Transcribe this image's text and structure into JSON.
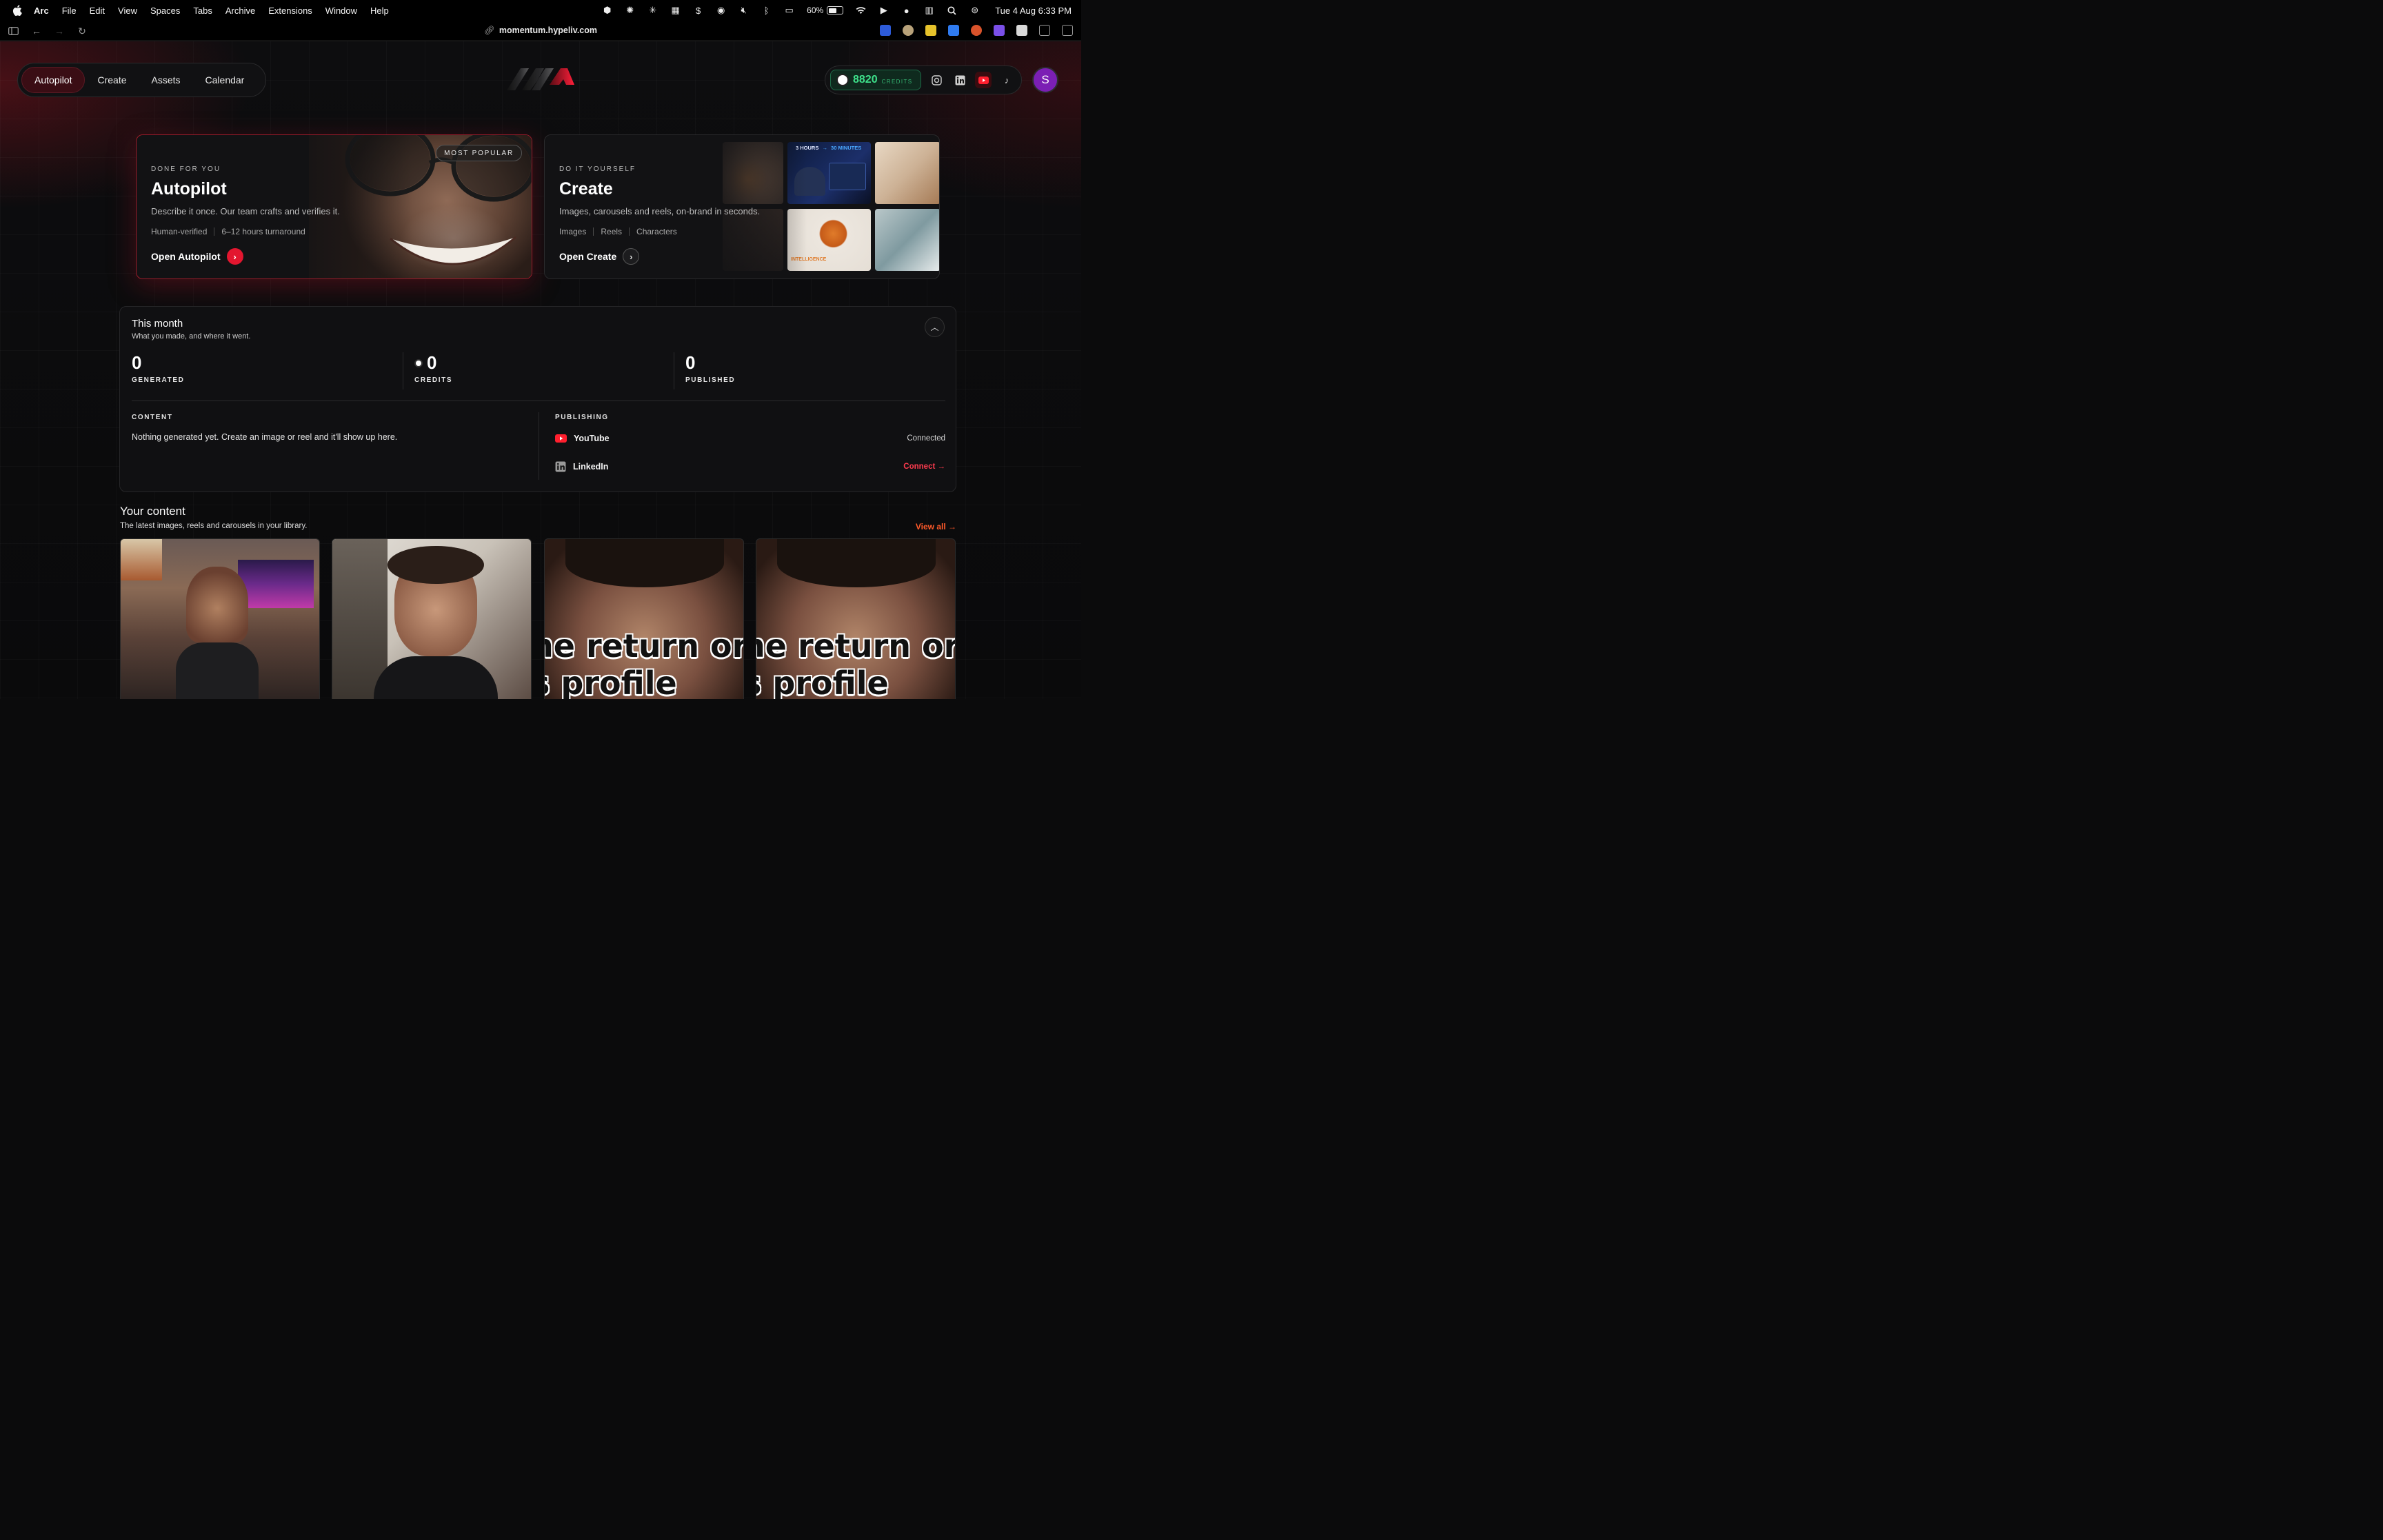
{
  "menubar": {
    "app": "Arc",
    "items": [
      "File",
      "Edit",
      "View",
      "Spaces",
      "Tabs",
      "Archive",
      "Extensions",
      "Window",
      "Help"
    ],
    "battery": "60%",
    "clock": "Tue 4 Aug  6:33 PM"
  },
  "browser": {
    "url": "momentum.hypeliv.com"
  },
  "nav": {
    "tabs": [
      "Autopilot",
      "Create",
      "Assets",
      "Calendar"
    ],
    "active": "Autopilot"
  },
  "header": {
    "credits_value": "8820",
    "credits_label": "CREDITS",
    "avatar_initial": "S"
  },
  "autopilot_card": {
    "badge": "MOST POPULAR",
    "eyebrow": "DONE FOR YOU",
    "title": "Autopilot",
    "description": "Describe it once. Our team crafts and verifies it.",
    "meta": [
      "Human-verified",
      "6–12 hours turnaround"
    ],
    "cta": "Open Autopilot"
  },
  "create_card": {
    "eyebrow": "DO IT YOURSELF",
    "title": "Create",
    "description": "Images, carousels and reels, on-brand in seconds.",
    "meta": [
      "Images",
      "Reels",
      "Characters"
    ],
    "cta": "Open Create",
    "thumb_text_1a": "3 HOURS",
    "thumb_text_1b": "30 MINUTES",
    "thumb_text_2": "INTELLIGENCE"
  },
  "month": {
    "title": "This month",
    "subtitle": "What you made, and where it went.",
    "stats": [
      {
        "value": "0",
        "label": "GENERATED"
      },
      {
        "value": "0",
        "label": "CREDITS"
      },
      {
        "value": "0",
        "label": "PUBLISHED"
      }
    ],
    "content_label": "CONTENT",
    "content_empty": "Nothing generated yet. Create an image or reel and it'll show up here.",
    "publishing_label": "PUBLISHING",
    "platforms": [
      {
        "name": "YouTube",
        "status": "Connected"
      },
      {
        "name": "LinkedIn",
        "status": "Connect →"
      }
    ]
  },
  "your_content": {
    "title": "Your content",
    "subtitle": "The latest images, reels and carousels in your library.",
    "view_all": "View all →",
    "tile_overlay_line1": "he return or",
    "tile_overlay_line2": "s profile"
  },
  "colors": {
    "accent_red": "#e3162f",
    "credits_green": "#3ee08a",
    "avatar_purple": "#7b1fb4",
    "link_orange": "#ff5a2a"
  }
}
